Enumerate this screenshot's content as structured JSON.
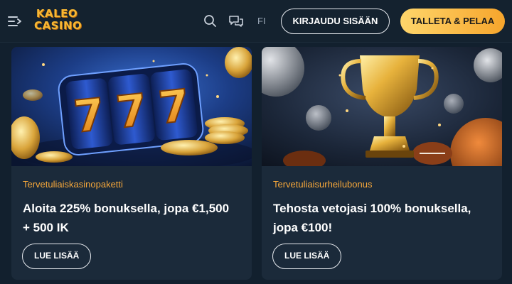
{
  "header": {
    "logo_line1": "KALEO",
    "logo_line2": "CASINO",
    "language": "FI",
    "login_label": "KIRJAUDU SISÄÄN",
    "deposit_label": "TALLETA & PELAA",
    "icons": [
      "menu-icon",
      "search-icon",
      "chat-icon"
    ]
  },
  "cards": [
    {
      "image": "slot-777-image",
      "tag": "Tervetuliaiskasinopaketti",
      "title": "Aloita 225% bonuksella, jopa €1,500 + 500 IK",
      "button": "LUE LISÄÄ"
    },
    {
      "image": "trophy-sports-image",
      "tag": "Tervetuliaisurheilubonus",
      "title": "Tehosta vetojasi 100% bonuksella, jopa €100!",
      "button": "LUE LISÄÄ"
    }
  ],
  "colors": {
    "background": "#12202e",
    "card": "#1b2a3a",
    "tag": "#f7a83a",
    "deposit_gradient": [
      "#ffd66b",
      "#f6a52c"
    ],
    "logo": "#f7b733"
  }
}
